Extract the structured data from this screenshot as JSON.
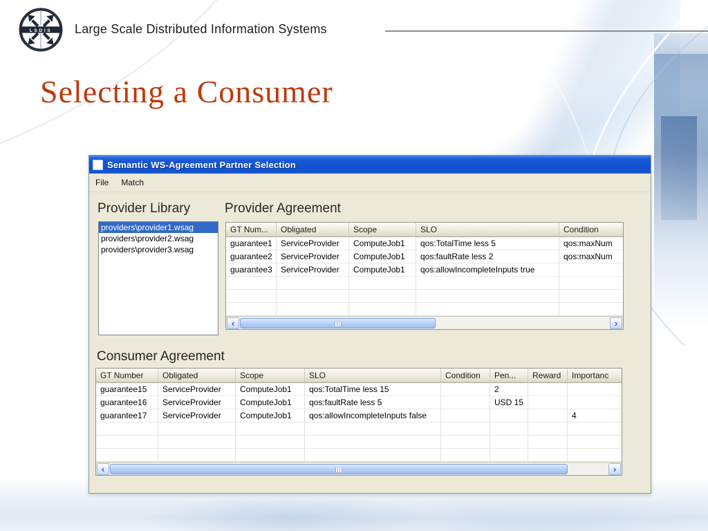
{
  "slide": {
    "logo_text": "LSDIS",
    "header_label": "Large Scale Distributed Information Systems",
    "title": "Selecting a Consumer"
  },
  "app": {
    "window_title": "Semantic WS-Agreement Partner Selection",
    "menu": [
      {
        "label": "File"
      },
      {
        "label": "Match"
      }
    ],
    "icons": {
      "scroll_left": "‹",
      "scroll_right": "›"
    },
    "provider_library": {
      "heading": "Provider Library",
      "selected_index": 0,
      "items": [
        "providers\\provider1.wsag",
        "providers\\provider2.wsag",
        "providers\\provider3.wsag"
      ]
    },
    "provider_agreement": {
      "heading": "Provider Agreement",
      "columns": [
        "GT Num...",
        "Obligated",
        "Scope",
        "SLO",
        "Condition"
      ],
      "rows": [
        [
          "guarantee1",
          "ServiceProvider",
          "ComputeJob1",
          "qos:TotalTime less 5",
          "qos:maxNum"
        ],
        [
          "guarantee2",
          "ServiceProvider",
          "ComputeJob1",
          "qos:faultRate less 2",
          "qos:maxNum"
        ],
        [
          "guarantee3",
          "ServiceProvider",
          "ComputeJob1",
          "qos:allowIncompleteInputs true",
          ""
        ]
      ],
      "empty_rows": 3,
      "hscroll_thumb_pct": 53
    },
    "consumer_agreement": {
      "heading": "Consumer Agreement",
      "columns": [
        "GT Number",
        "Obligated",
        "Scope",
        "SLO",
        "Condition",
        "Pen...",
        "Reward",
        "Importanc"
      ],
      "rows": [
        [
          "guarantee15",
          "ServiceProvider",
          "ComputeJob1",
          "qos:TotalTime less 15",
          "",
          "2",
          "",
          ""
        ],
        [
          "guarantee16",
          "ServiceProvider",
          "ComputeJob1",
          "qos:faultRate less 5",
          "",
          "USD 15",
          "",
          ""
        ],
        [
          "guarantee17",
          "ServiceProvider",
          "ComputeJob1",
          "qos:allowIncompleteInputs false",
          "",
          "",
          "",
          "4"
        ]
      ],
      "empty_rows": 3,
      "hscroll_thumb_pct": 92
    }
  },
  "colors": {
    "titlebar_blue": "#1355d8",
    "selection_blue": "#316ac5",
    "slide_title_red": "#bd3a0e"
  }
}
